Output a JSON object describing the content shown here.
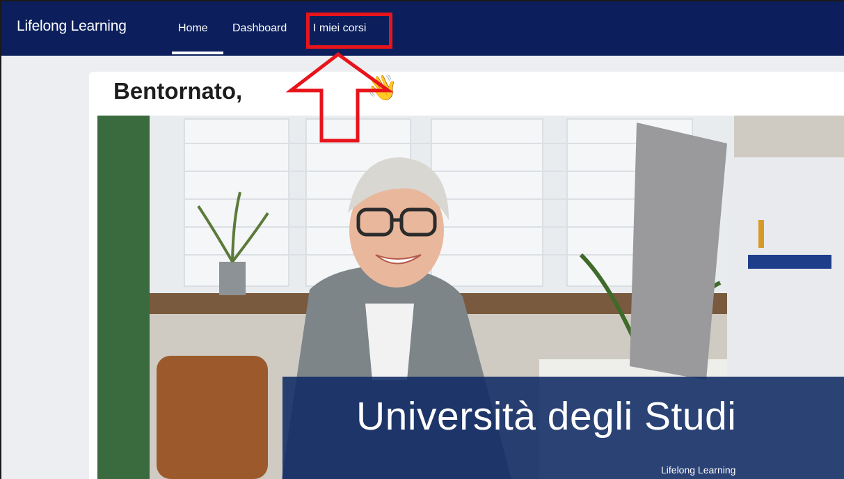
{
  "navbar": {
    "brand": "Lifelong Learning",
    "items": [
      {
        "label": "Home",
        "active": true
      },
      {
        "label": "Dashboard",
        "active": false
      },
      {
        "label": "I miei corsi",
        "active": false,
        "highlighted": true
      }
    ]
  },
  "main": {
    "welcome": "Bentornato,",
    "wave_icon": "👋",
    "hero": {
      "title": "Università degli Studi",
      "subtitle": "Lifelong Learning"
    }
  },
  "colors": {
    "navbar": "#0c1f5c",
    "highlight": "#e8141b",
    "green_strip": "#3a6b3e",
    "overlay": "#102a64"
  },
  "annotation": {
    "type": "red-arrow",
    "target": "I miei corsi"
  }
}
